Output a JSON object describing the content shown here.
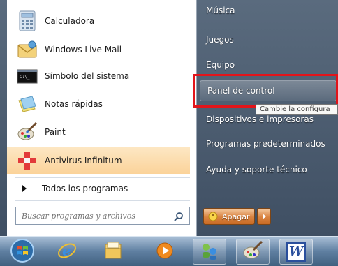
{
  "start_menu": {
    "pinned_programs": [
      {
        "label": "Calculadora",
        "icon": "calculator-icon"
      },
      {
        "label": "Windows Live Mail",
        "icon": "mail-icon"
      },
      {
        "label": "Símbolo del sistema",
        "icon": "command-prompt-icon"
      },
      {
        "label": "Notas rápidas",
        "icon": "sticky-notes-icon"
      },
      {
        "label": "Paint",
        "icon": "paint-icon"
      },
      {
        "label": "Antivirus Infinitum",
        "icon": "antivirus-icon"
      }
    ],
    "all_programs_label": "Todos los programas",
    "search_placeholder": "Buscar programas y archivos",
    "right_links": {
      "music": "Música",
      "games": "Juegos",
      "computer": "Equipo",
      "control_panel": "Panel de control",
      "devices": "Dispositivos e impresoras",
      "default_programs": "Programas predeterminados",
      "help": "Ayuda y soporte técnico"
    },
    "tooltip": "Cambie la configura",
    "shutdown_label": "Apagar",
    "highlight_color": "#e2141a"
  },
  "taskbar": {
    "items": [
      "start-orb-icon",
      "internet-explorer-icon",
      "explorer-folder-icon",
      "media-player-icon",
      "network-people-icon",
      "paint-icon",
      "word-icon"
    ],
    "word_letter": "W"
  }
}
